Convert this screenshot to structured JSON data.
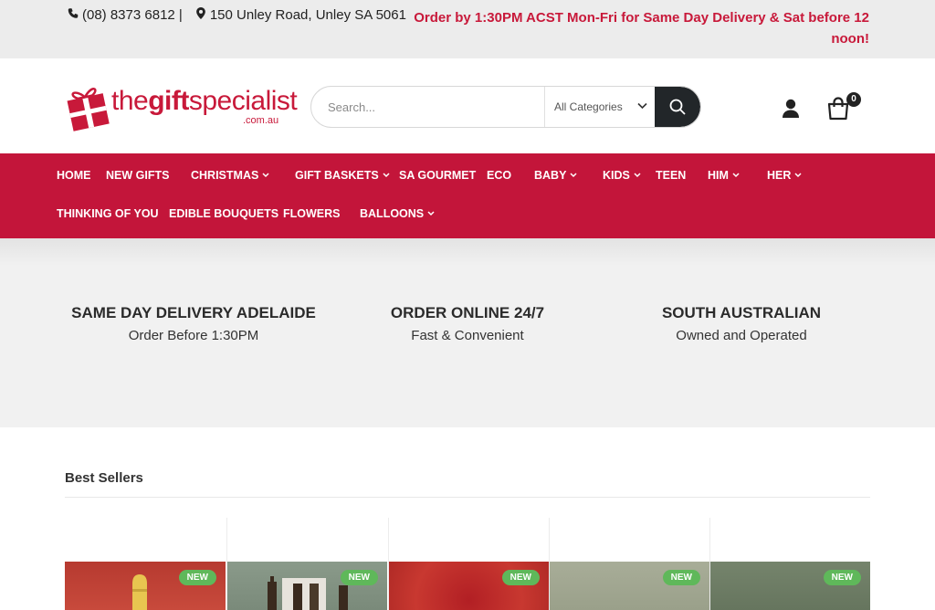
{
  "topbar": {
    "phone": "(08) 8373 6812 |",
    "address": "150 Unley Road, Unley SA 5061",
    "promo": "Order by 1:30PM ACST Mon-Fri for Same Day Delivery & Sat before 12 noon!"
  },
  "logo": {
    "brand_pre": "the",
    "brand_bold": "gift",
    "brand_post": "specialist",
    "tld": ".com.au"
  },
  "search": {
    "placeholder": "Search...",
    "category": "All Categories"
  },
  "cart": {
    "count": "0"
  },
  "nav": {
    "items": [
      "HOME",
      "NEW GIFTS",
      "CHRISTMAS",
      "GIFT BASKETS",
      "SA GOURMET",
      "ECO",
      "BABY",
      "KIDS",
      "TEEN",
      "HIM",
      "HER",
      "THINKING OF YOU",
      "EDIBLE BOUQUETS",
      "FLOWERS",
      "BALLOONS"
    ]
  },
  "features": [
    {
      "title": "SAME DAY DELIVERY ADELAIDE",
      "subtitle": "Order Before 1:30PM"
    },
    {
      "title": "ORDER ONLINE 24/7",
      "subtitle": "Fast & Convenient"
    },
    {
      "title": "SOUTH AUSTRALIAN",
      "subtitle": "Owned and Operated"
    }
  ],
  "best_sellers": {
    "title": "Best Sellers",
    "badge": "NEW"
  },
  "colors": {
    "brand_red": "#c3153a",
    "promo_red": "#c8193a",
    "badge_green": "#5fb85a",
    "search_button": "#222629"
  }
}
